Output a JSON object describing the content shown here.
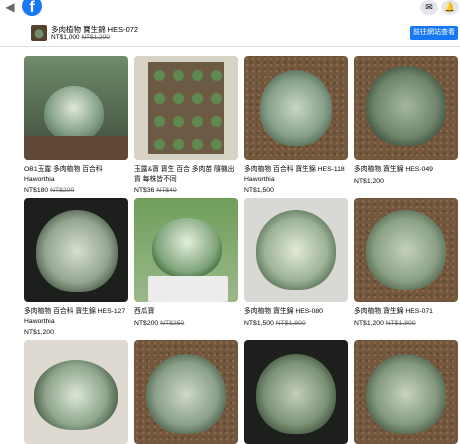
{
  "topbar": {
    "back_icon": "arrow-left-icon",
    "logo_letter": "f",
    "messenger_icon": "messenger-icon",
    "bell_icon": "bell-icon"
  },
  "product_bar": {
    "title": "多肉植物 寶生錦 HES-072",
    "price_now": "NT$1,000",
    "price_old": "NT$1,200",
    "button_label": "前往網站查看"
  },
  "products": [
    {
      "name": "OB1玉露 多肉植物 百合科",
      "name2": "Haworthia",
      "price_now": "NT$180",
      "price_old": "NT$200"
    },
    {
      "name": "玉露&寶 寶生 百合 多肉苗 隨機出",
      "name2": "貨 每株皆不同",
      "price_now": "NT$36",
      "price_old": "NT$40"
    },
    {
      "name": "多肉植物 百合科 寶生錦 HES-118",
      "name2": "Haworthia",
      "price_now": "NT$1,500",
      "price_old": ""
    },
    {
      "name": "多肉植物 寶生錦 HES-049",
      "name2": "",
      "price_now": "NT$1,200",
      "price_old": ""
    },
    {
      "name": "多肉植物 百合科 寶生錦 HES-127",
      "name2": "Haworthia",
      "price_now": "NT$1,200",
      "price_old": ""
    },
    {
      "name": "西瓜寶",
      "name2": "",
      "price_now": "NT$200",
      "price_old": "NT$250"
    },
    {
      "name": "多肉植物 寶生錦 HES-080",
      "name2": "",
      "price_now": "NT$1,500",
      "price_old": "NT$1,800"
    },
    {
      "name": "多肉植物 寶生錦 HES-071",
      "name2": "",
      "price_now": "NT$1,200",
      "price_old": "NT$1,800"
    },
    {
      "name": "",
      "name2": "",
      "price_now": "",
      "price_old": ""
    },
    {
      "name": "",
      "name2": "",
      "price_now": "",
      "price_old": ""
    },
    {
      "name": "",
      "name2": "",
      "price_now": "",
      "price_old": ""
    },
    {
      "name": "",
      "name2": "",
      "price_now": "",
      "price_old": ""
    }
  ],
  "colors": {
    "brand": "#1877f2",
    "muted": "#65676b",
    "divider": "#dadde1"
  }
}
